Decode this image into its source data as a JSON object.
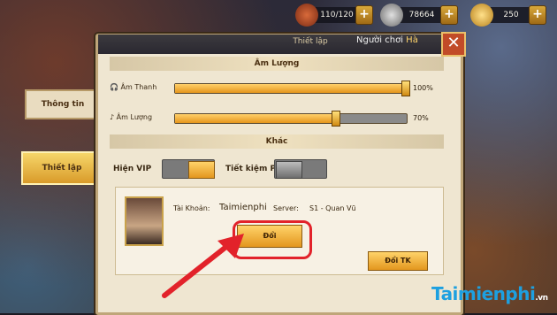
{
  "resources": [
    {
      "value": "110/120",
      "icon": "energy-icon"
    },
    {
      "value": "78664",
      "icon": "coin-icon"
    },
    {
      "value": "250",
      "icon": "ingot-icon"
    }
  ],
  "panel": {
    "title": "Thiết lập",
    "player_label": "Người chơi",
    "player_name": "Hà"
  },
  "tabs": {
    "info": "Thông tin",
    "setup": "Thiết lập"
  },
  "sound": {
    "section": "Âm Lượng",
    "music_label": "Âm Thanh",
    "music_value": "100%",
    "music_level": 1.0,
    "effects_label": "Âm Lượng",
    "effects_value": "70%",
    "effects_level": 0.7
  },
  "other": {
    "section": "Khác",
    "vip_label": "Hiện VIP",
    "battery_label": "Tiết kiệm Pin"
  },
  "account": {
    "account_label": "Tài Khoản:",
    "account_name": "Taimienphi",
    "server_label": "Server:",
    "server_value": "S1 - Quan Vũ",
    "change_button": "Đổi",
    "change_account_button": "Đổi TK"
  },
  "watermark": {
    "brand": "Taimienphi",
    ".vn": ".vn"
  }
}
